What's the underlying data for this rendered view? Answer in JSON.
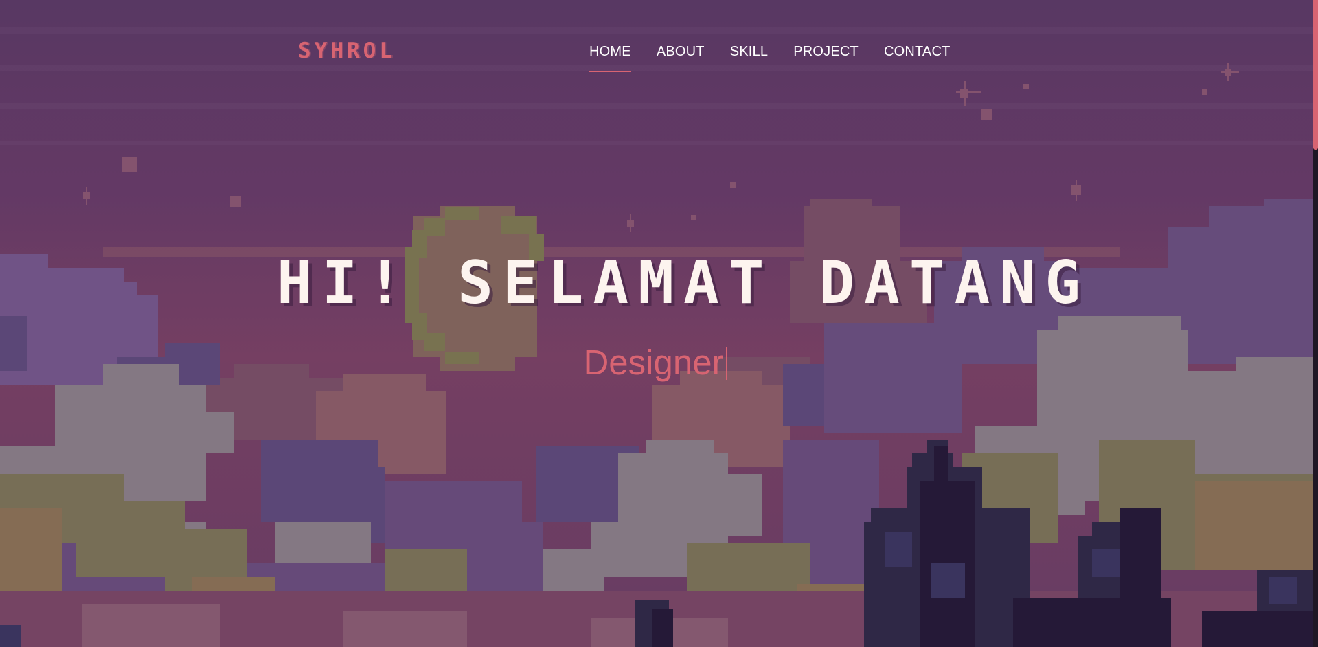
{
  "brand": {
    "logo_text": "SYHROL"
  },
  "nav": {
    "items": [
      {
        "label": "HOME",
        "active": true
      },
      {
        "label": "ABOUT",
        "active": false
      },
      {
        "label": "SKILL",
        "active": false
      },
      {
        "label": "PROJECT",
        "active": false
      },
      {
        "label": "CONTACT",
        "active": false
      }
    ]
  },
  "hero": {
    "title": "HI! SELAMAT DATANG",
    "typed_text": "Designer"
  },
  "colors": {
    "accent": "#d86472",
    "sky_top": "#5b3b66",
    "title_text": "#fdf4ef"
  }
}
